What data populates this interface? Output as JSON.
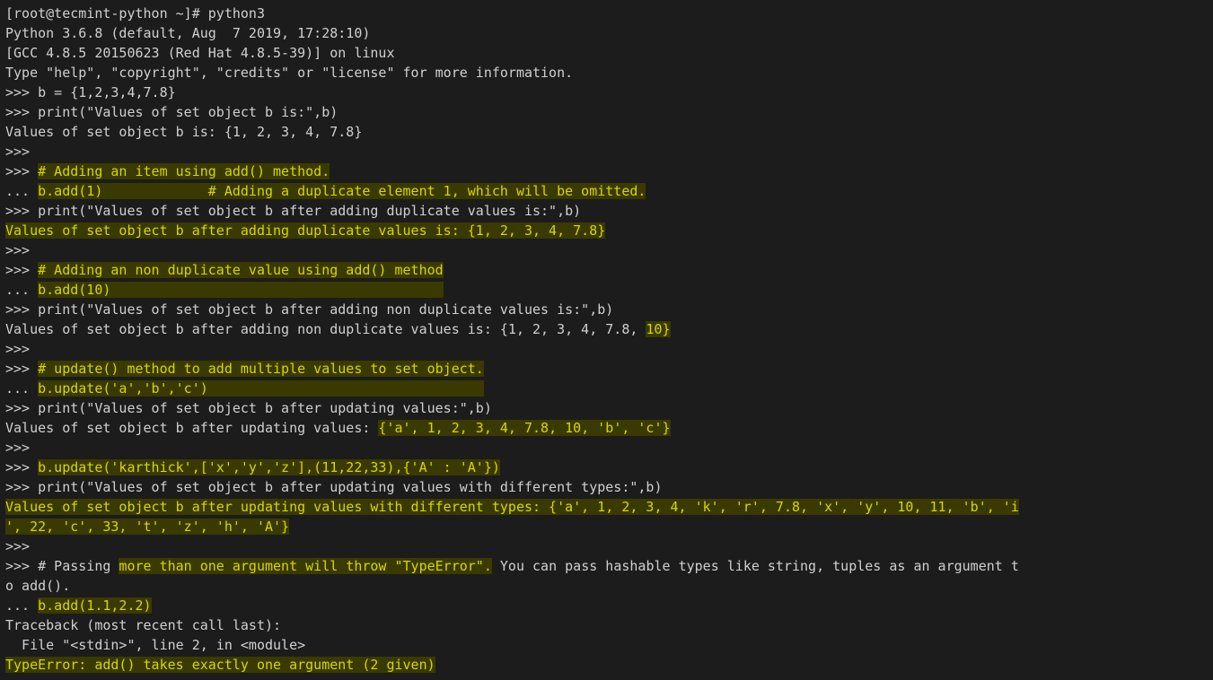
{
  "lines": [
    {
      "segments": [
        {
          "t": "[root@tecmint-python ~]# python3"
        }
      ]
    },
    {
      "segments": [
        {
          "t": "Python 3.6.8 (default, Aug  7 2019, 17:28:10)"
        }
      ]
    },
    {
      "segments": [
        {
          "t": "[GCC 4.8.5 20150623 (Red Hat 4.8.5-39)] on linux"
        }
      ]
    },
    {
      "segments": [
        {
          "t": "Type \"help\", \"copyright\", \"credits\" or \"license\" for more information."
        }
      ]
    },
    {
      "segments": [
        {
          "t": ">>> b = {1,2,3,4,7.8}"
        }
      ]
    },
    {
      "segments": [
        {
          "t": ">>> print(\"Values of set object b is:\",b)"
        }
      ]
    },
    {
      "segments": [
        {
          "t": "Values of set object b is: {1, 2, 3, 4, 7.8}"
        }
      ]
    },
    {
      "segments": [
        {
          "t": ">>>"
        }
      ]
    },
    {
      "segments": [
        {
          "t": ">>> "
        },
        {
          "t": "# Adding an item using add() method.",
          "c": "hl"
        }
      ]
    },
    {
      "segments": [
        {
          "t": "... "
        },
        {
          "t": "b.add(1)             # Adding a duplicate element 1, which will be omitted.",
          "c": "hl"
        }
      ]
    },
    {
      "segments": [
        {
          "t": ">>> print(\"Values of set object b after adding duplicate values is:\",b)"
        }
      ]
    },
    {
      "segments": [
        {
          "t": "Values of set object b after adding duplicate values is: {1, 2, 3, 4, 7.8}",
          "c": "hl"
        }
      ]
    },
    {
      "segments": [
        {
          "t": ">>>"
        }
      ]
    },
    {
      "segments": [
        {
          "t": ">>> "
        },
        {
          "t": "# Adding an non duplicate value using add() method",
          "c": "hl"
        }
      ]
    },
    {
      "segments": [
        {
          "t": "... "
        },
        {
          "t": "b.add(10)                                         ",
          "c": "hl"
        }
      ]
    },
    {
      "segments": [
        {
          "t": ">>> print(\"Values of set object b after adding non duplicate values is:\",b)"
        }
      ]
    },
    {
      "segments": [
        {
          "t": "Values of set object b after adding non duplicate values is: {1, 2, 3, 4, 7.8, "
        },
        {
          "t": "10}",
          "c": "hl"
        }
      ]
    },
    {
      "segments": [
        {
          "t": ">>>"
        }
      ]
    },
    {
      "segments": [
        {
          "t": ">>> "
        },
        {
          "t": "# update() method to add multiple values to set object.",
          "c": "hl"
        }
      ]
    },
    {
      "segments": [
        {
          "t": "... "
        },
        {
          "t": "b.update('a','b','c')                                  ",
          "c": "hl"
        }
      ]
    },
    {
      "segments": [
        {
          "t": ">>> print(\"Values of set object b after updating values:\",b)"
        }
      ]
    },
    {
      "segments": [
        {
          "t": "Values of set object b after updating values: "
        },
        {
          "t": "{'a', 1, 2, 3, 4, 7.8, 10, 'b', 'c'}",
          "c": "hl"
        }
      ]
    },
    {
      "segments": [
        {
          "t": ">>>"
        }
      ]
    },
    {
      "segments": [
        {
          "t": ">>> "
        },
        {
          "t": "b.update('karthick',['x','y','z'],(11,22,33),{'A' : 'A'})",
          "c": "hl"
        }
      ]
    },
    {
      "segments": [
        {
          "t": ">>> print(\"Values of set object b after updating values with different types:\",b)"
        }
      ]
    },
    {
      "segments": [
        {
          "t": "Values of set object b after updating values with different types: {'a', 1, 2, 3, 4, 'k', 'r', 7.8, 'x', 'y', 10, 11, 'b', 'i",
          "c": "hl"
        }
      ]
    },
    {
      "segments": [
        {
          "t": "', 22, 'c', 33, 't', 'z', 'h', 'A'}",
          "c": "hl"
        }
      ]
    },
    {
      "segments": [
        {
          "t": ">>>"
        }
      ]
    },
    {
      "segments": [
        {
          "t": ">>> # Passing "
        },
        {
          "t": "more than one argument will throw \"TypeError\".",
          "c": "hl"
        },
        {
          "t": " You can pass hashable types like string, tuples as an argument t"
        }
      ]
    },
    {
      "segments": [
        {
          "t": "o add()."
        }
      ]
    },
    {
      "segments": [
        {
          "t": "... "
        },
        {
          "t": "b.add(1.1,2.2)",
          "c": "hl"
        }
      ]
    },
    {
      "segments": [
        {
          "t": "Traceback (most recent call last):"
        }
      ]
    },
    {
      "segments": [
        {
          "t": "  File \"<stdin>\", line 2, in <module>"
        }
      ]
    },
    {
      "segments": [
        {
          "t": "TypeError: add() takes exactly one argument (2 given)",
          "c": "hl"
        }
      ]
    }
  ]
}
